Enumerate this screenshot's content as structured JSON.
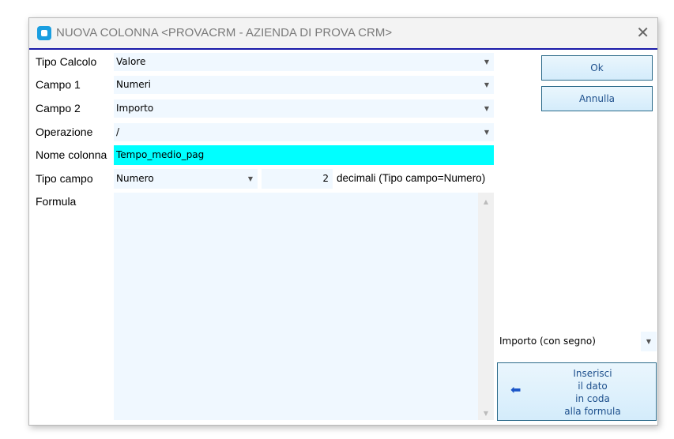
{
  "window": {
    "title": "NUOVA COLONNA <PROVACRM - AZIENDA DI PROVA CRM>"
  },
  "form": {
    "tipo_calcolo": {
      "label": "Tipo Calcolo",
      "value": "Valore"
    },
    "campo1": {
      "label": "Campo 1",
      "value": "Numeri"
    },
    "campo2": {
      "label": "Campo 2",
      "value": "Importo"
    },
    "operazione": {
      "label": "Operazione",
      "value": "/"
    },
    "nome_colonna": {
      "label": "Nome colonna",
      "value": "Tempo_medio_pag"
    },
    "tipo_campo": {
      "label": "Tipo campo",
      "value": "Numero",
      "decimali": "2",
      "decimali_label": "decimali (Tipo campo=Numero)"
    },
    "formula": {
      "label": "Formula",
      "value": ""
    }
  },
  "buttons": {
    "ok": "Ok",
    "annulla": "Annulla",
    "inserisci": [
      "Inserisci",
      "il dato",
      "in coda",
      "alla formula"
    ]
  },
  "field_select": {
    "value": "Importo (con segno)"
  }
}
